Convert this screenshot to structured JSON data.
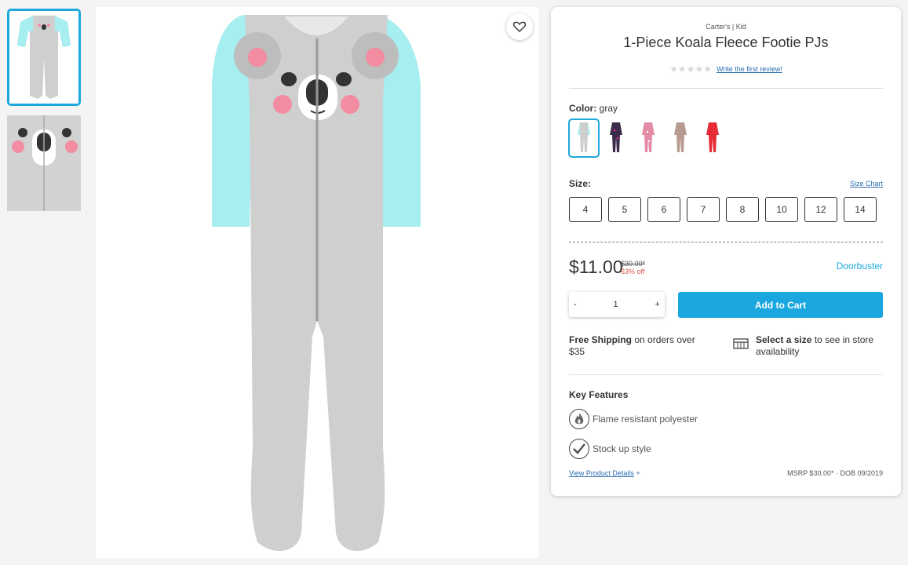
{
  "product": {
    "brand": "Carter's | Kid",
    "title": "1-Piece Koala Fleece Footie PJs",
    "review_link": "Write the first review!",
    "stars": "★★★★★"
  },
  "color": {
    "label": "Color:",
    "value": "gray",
    "swatches": [
      {
        "name": "gray koala",
        "color": "#cfe9ea"
      },
      {
        "name": "navy print",
        "color": "#3b2b4a"
      },
      {
        "name": "pink print",
        "color": "#e48aa4"
      },
      {
        "name": "mauve",
        "color": "#b79a90"
      },
      {
        "name": "red",
        "color": "#e52b36"
      }
    ]
  },
  "size": {
    "label": "Size:",
    "chart_link": "Size Chart",
    "options": [
      "4",
      "5",
      "6",
      "7",
      "8",
      "10",
      "12",
      "14"
    ]
  },
  "price": {
    "sale": "$11.00",
    "original": "$30.00*",
    "discount": "63% off",
    "badge": "Doorbuster"
  },
  "quantity": {
    "minus": "-",
    "value": "1",
    "plus": "+"
  },
  "cart": {
    "add_label": "Add to Cart"
  },
  "shipping": {
    "bold": "Free Shipping",
    "rest": " on orders over $35"
  },
  "store": {
    "bold": "Select a size",
    "rest": " to see in store availability"
  },
  "features": {
    "title": "Key Features",
    "items": [
      "Flame resistant polyester",
      "Stock up style"
    ],
    "details_link": "View Product Details",
    "details_plus": "+",
    "msrp": "MSRP $30.00* · DOB 09/2019"
  },
  "colors": {
    "accent": "#1da8dd",
    "cart_button": "#1aa6df",
    "discount": "#d9534f",
    "sleeve": "#a6eef0",
    "body": "#cfcfcf"
  },
  "icons": {
    "favorite": "heart-icon",
    "store": "store-icon",
    "flame": "flame-icon",
    "check": "checkmark-icon"
  }
}
